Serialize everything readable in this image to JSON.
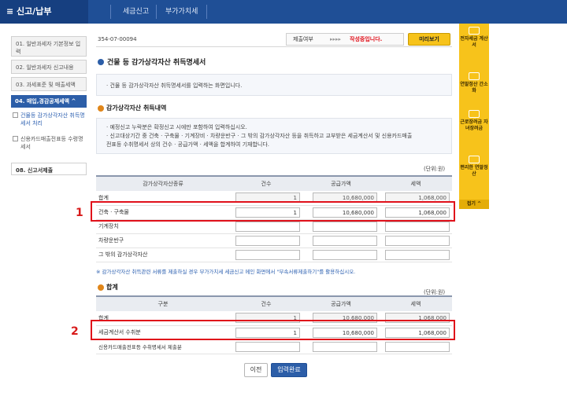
{
  "topnav": {
    "menu_label": "≡ 신고/납부",
    "crumb1": "세금신고",
    "crumb2": "부가가치세"
  },
  "sidebar": {
    "items": [
      {
        "label": "01. 일반과세자 기본정보 입력"
      },
      {
        "label": "02. 일반과세자 신고내용"
      },
      {
        "label": "03. 과세표준 및 매출세액"
      },
      {
        "label": "04. 매입,경감공제세액 ^"
      }
    ],
    "subitems": [
      {
        "label": "건물등 감가상각자산 취득명세서 처리"
      },
      {
        "label": "신용카드매출전표등 수령명세서"
      }
    ],
    "last": {
      "label": "08. 신고서제출"
    }
  },
  "header": {
    "biz_number": "354-07-00094",
    "status_label": "제출여부",
    "status_arrows": "▸▸▸▸",
    "status_value": "작성중입니다.",
    "preview_button": "미리보기"
  },
  "page": {
    "title": "건물 등 감가상각자산 취득명세서",
    "intro": "· 건물 등 감가상각자산 취득명세서를 입력하는 화면입니다."
  },
  "section1": {
    "title": "감가상각자산 취득내역",
    "notes": [
      "· 예정신고 누락분은 확정신고 시에만 포함하여 입력하십시오.",
      "· 신고대상기간 중 건축 · 구축물 · 기계장비 · 차량운반구 · 그 밖의 감가상각자산 등을 취득하고 교부받은 세금계산서 및 신용카드매출",
      "  전표등 수취명세서 상의 건수 · 공급가액 · 세액을 합계하여 기재합니다."
    ],
    "unit": "(단위:원)",
    "columns": [
      "감가상각자산종류",
      "건수",
      "공급가액",
      "세액"
    ],
    "rows": [
      {
        "label": "합계",
        "count": "1",
        "supply": "10,680,000",
        "tax": "1,068,000"
      },
      {
        "label": "건축 · 구축물",
        "count": "1",
        "supply": "10,680,000",
        "tax": "1,068,000"
      },
      {
        "label": "기계장치",
        "count": "",
        "supply": "",
        "tax": ""
      },
      {
        "label": "차량운반구",
        "count": "",
        "supply": "",
        "tax": ""
      },
      {
        "label": "그 밖의 감가상각자산",
        "count": "",
        "supply": "",
        "tax": ""
      }
    ],
    "footnote": "※ 감가상각자산 취득관련 서류를 제출하실 경우 부가가치세 세금신고 메인 화면에서 \"부속서류제출하기\"를 활용하십시오."
  },
  "section2": {
    "title": "합계",
    "unit": "(단위:원)",
    "columns": [
      "구분",
      "건수",
      "공급가액",
      "세액"
    ],
    "rows": [
      {
        "label": "합계",
        "count": "1",
        "supply": "10,680,000",
        "tax": "1,068,000"
      },
      {
        "label": "세금계산서 수취분",
        "count": "1",
        "supply": "10,680,000",
        "tax": "1,068,000"
      },
      {
        "label": "신용카드매출전표등 수취명세서 제출분",
        "count": "",
        "supply": "",
        "tax": ""
      }
    ]
  },
  "buttons": {
    "prev": "이전",
    "submit": "입력완료"
  },
  "annotations": {
    "one": "1",
    "two": "2"
  },
  "rail": {
    "items": [
      {
        "label": "전자세금 계산서",
        "icon": "invoice-icon"
      },
      {
        "label": "연말정산 간소화",
        "icon": "document-icon"
      },
      {
        "label": "근로장려금 자녀장려금",
        "icon": "heart-icon"
      },
      {
        "label": "편리한 연말정산",
        "icon": "calculator-icon"
      }
    ],
    "close": "접기 ^"
  },
  "colors": {
    "nav": "#1f4f96",
    "accent_red": "#e0101a",
    "rail": "#f7c31b",
    "active_sidebar": "#2c5ea8"
  }
}
